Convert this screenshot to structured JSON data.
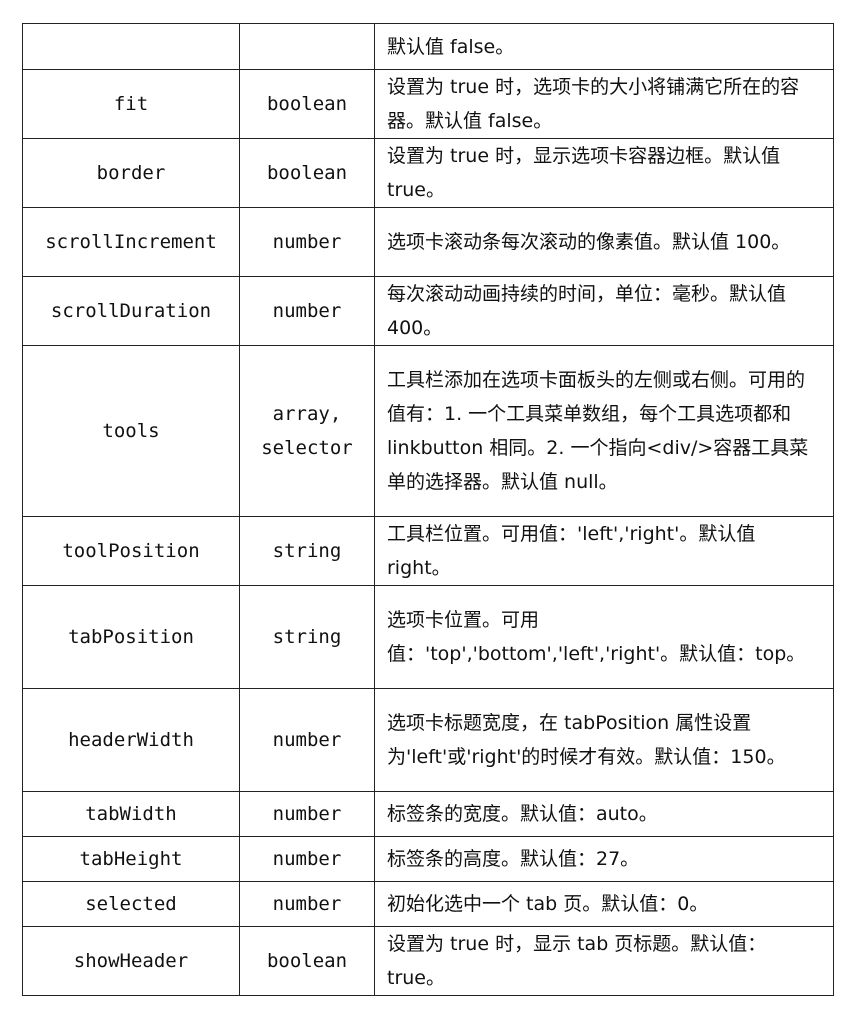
{
  "rows": [
    {
      "name": "",
      "type": "",
      "desc": "默认值 false。"
    },
    {
      "name": "fit",
      "type": "boolean",
      "desc": "设置为 true 时，选项卡的大小将铺满它所在的容器。默认值 false。"
    },
    {
      "name": "border",
      "type": "boolean",
      "desc": "设置为 true 时，显示选项卡容器边框。默认值 true。"
    },
    {
      "name": "scrollIncrement",
      "type": "number",
      "desc": "选项卡滚动条每次滚动的像素值。默认值 100。"
    },
    {
      "name": "scrollDuration",
      "type": "number",
      "desc": "每次滚动动画持续的时间，单位：毫秒。默认值400。"
    },
    {
      "name": "tools",
      "type": "array, selector",
      "desc": "工具栏添加在选项卡面板头的左侧或右侧。可用的值有：1. 一个工具菜单数组，每个工具选项都和 linkbutton 相同。2. 一个指向<div/>容器工具菜单的选择器。默认值 null。"
    },
    {
      "name": "toolPosition",
      "type": "string",
      "desc": "工具栏位置。可用值：'left','right'。默认值 right。"
    },
    {
      "name": "tabPosition",
      "type": "string",
      "desc": "选项卡位置。可用值：'top','bottom','left','right'。默认值：top。"
    },
    {
      "name": "headerWidth",
      "type": "number",
      "desc": "选项卡标题宽度，在 tabPosition 属性设置为'left'或'right'的时候才有效。默认值：150。"
    },
    {
      "name": "tabWidth",
      "type": "number",
      "desc": "标签条的宽度。默认值：auto。"
    },
    {
      "name": "tabHeight",
      "type": "number",
      "desc": "标签条的高度。默认值：27。"
    },
    {
      "name": "selected",
      "type": "number",
      "desc": "初始化选中一个 tab 页。默认值：0。"
    },
    {
      "name": "showHeader",
      "type": "boolean",
      "desc": "设置为 true 时，显示 tab 页标题。默认值：true。"
    }
  ]
}
